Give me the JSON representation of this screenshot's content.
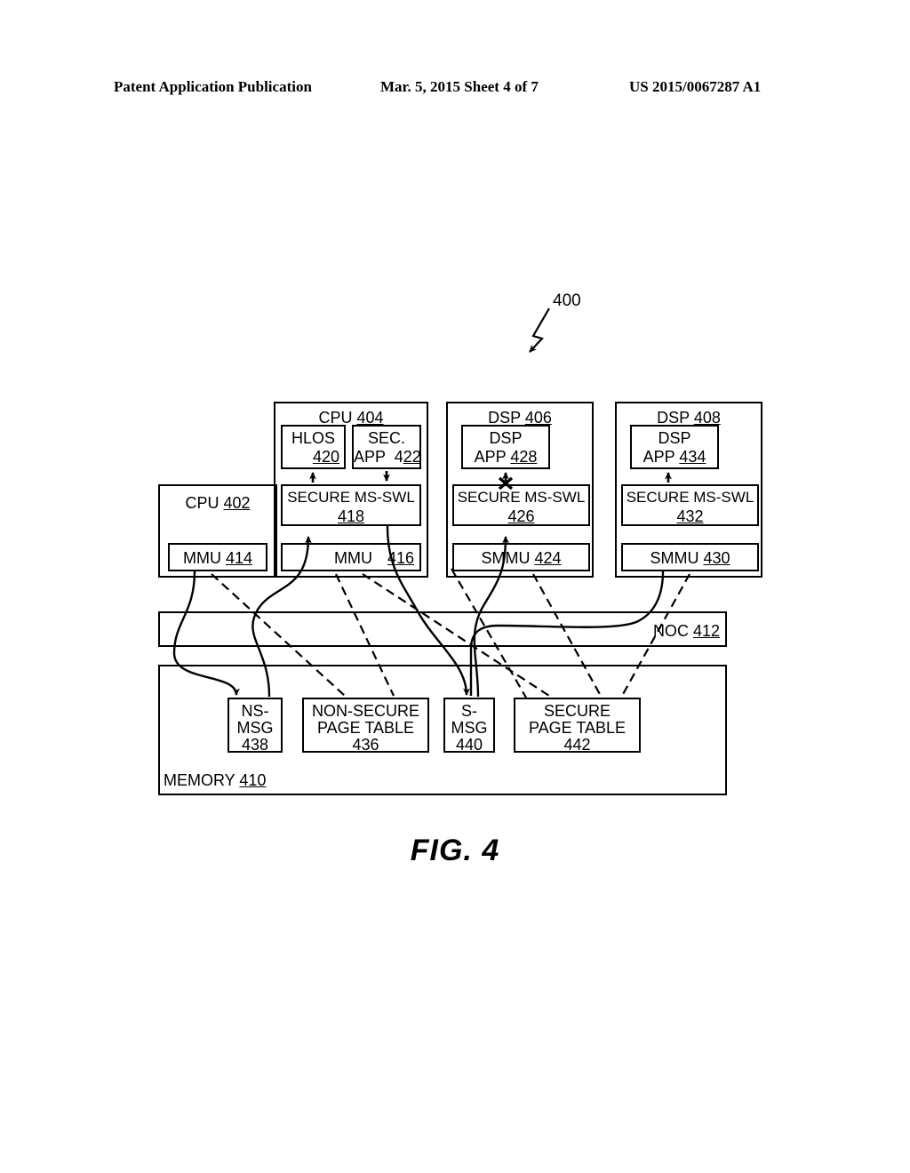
{
  "header": {
    "publication": "Patent Application Publication",
    "date_sheet": "Mar. 5, 2015  Sheet 4 of 7",
    "patent_number": "US 2015/0067287 A1"
  },
  "figure": {
    "caption": "FIG. 4",
    "system_ref": "400"
  },
  "diagram": {
    "cpu402": {
      "title": "CPU",
      "ref": "402",
      "mmu": {
        "label": "MMU",
        "ref": "414"
      }
    },
    "cpu404": {
      "title": "CPU",
      "ref": "404",
      "hlos": {
        "label": "HLOS",
        "ref": "420"
      },
      "sec_app": {
        "line1": "SEC.",
        "line2": "APP",
        "ref": "422"
      },
      "ms_swl": {
        "label": "SECURE MS-SWL",
        "ref": "418"
      },
      "mmu": {
        "label": "MMU",
        "ref": "416"
      }
    },
    "dsp406": {
      "title": "DSP",
      "ref": "406",
      "app": {
        "line1": "DSP",
        "line2": "APP",
        "ref": "428"
      },
      "ms_swl": {
        "label": "SECURE MS-SWL",
        "ref": "426"
      },
      "smmu": {
        "label": "SMMU",
        "ref": "424"
      },
      "blocked_mark": "x"
    },
    "dsp408": {
      "title": "DSP",
      "ref": "408",
      "app": {
        "line1": "DSP",
        "line2": "APP",
        "ref": "434"
      },
      "ms_swl": {
        "label": "SECURE MS-SWL",
        "ref": "432"
      },
      "smmu": {
        "label": "SMMU",
        "ref": "430"
      }
    },
    "noc": {
      "label": "NOC",
      "ref": "412"
    },
    "memory": {
      "label": "MEMORY",
      "ref": "410",
      "ns_msg": {
        "line1": "NS-",
        "line2": "MSG",
        "ref": "438"
      },
      "ns_page_table": {
        "line1": "NON-SECURE",
        "line2": "PAGE TABLE",
        "ref": "436"
      },
      "s_msg": {
        "line1": "S-",
        "line2": "MSG",
        "ref": "440"
      },
      "s_page_table": {
        "line1": "SECURE",
        "line2": "PAGE TABLE",
        "ref": "442"
      }
    }
  }
}
